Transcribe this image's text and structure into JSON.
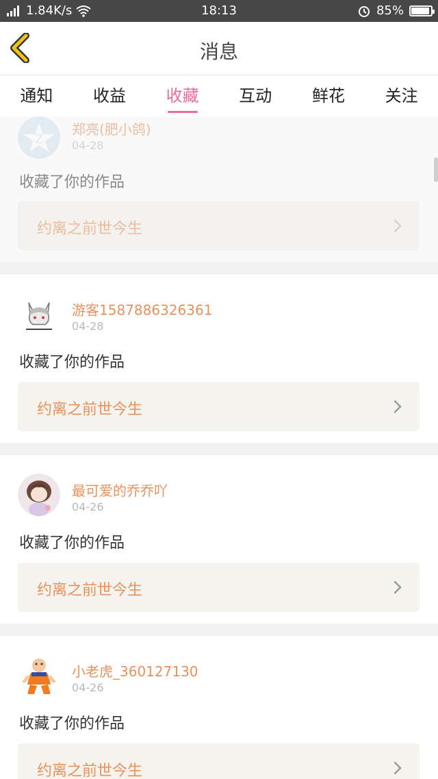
{
  "status_bar": {
    "network": "4G",
    "speed": "1.84K/s",
    "time": "18:13",
    "battery": "85%"
  },
  "header": {
    "title": "消息",
    "back_icon": "chevron-left-icon",
    "accent_color": "#f2c21a"
  },
  "tabs": [
    {
      "label": "通知",
      "active": false
    },
    {
      "label": "收益",
      "active": false
    },
    {
      "label": "收藏",
      "active": true
    },
    {
      "label": "互动",
      "active": false
    },
    {
      "label": "鲜花",
      "active": false
    },
    {
      "label": "关注",
      "active": false
    }
  ],
  "colors": {
    "tab_active": "#ea6c9a",
    "username": "#e9915c",
    "work_title": "#e9915c",
    "work_bg": "#f4f3ee"
  },
  "feed": [
    {
      "username": "郑亮(肥小鸽)",
      "date": "04-28",
      "action": "收藏了你的作品",
      "work": "约离之前世今生",
      "avatar": "default-avatar"
    },
    {
      "username": "游客1587886326361",
      "date": "04-28",
      "action": "收藏了你的作品",
      "work": "约离之前世今生",
      "avatar": "cat-avatar"
    },
    {
      "username": "最可爱的乔乔吖",
      "date": "04-26",
      "action": "收藏了你的作品",
      "work": "约离之前世今生",
      "avatar": "girl-avatar"
    },
    {
      "username": "小老虎_360127130",
      "date": "04-26",
      "action": "收藏了你的作品",
      "work": "约离之前世今生",
      "avatar": "monk-avatar"
    }
  ]
}
